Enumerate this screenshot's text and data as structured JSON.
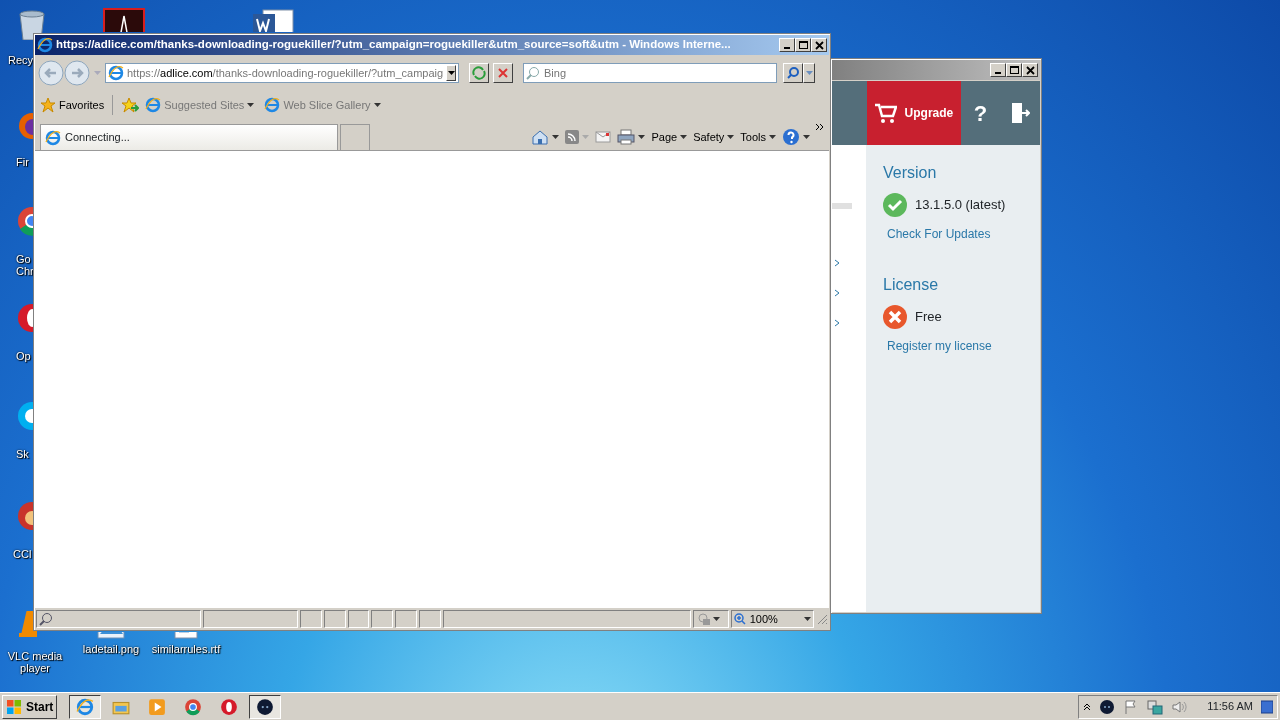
{
  "desktop_icons": [
    {
      "kind": "recycle-bin",
      "lines": [
        "Recy"
      ]
    },
    {
      "kind": "firefox",
      "lines": [
        "Fir"
      ]
    },
    {
      "kind": "chrome",
      "lines": [
        "Go",
        "Chr"
      ]
    },
    {
      "kind": "opera",
      "lines": [
        "Op"
      ]
    },
    {
      "kind": "skype",
      "lines": [
        "Sk"
      ]
    },
    {
      "kind": "ccleaner",
      "lines": [
        "CCl"
      ]
    },
    {
      "kind": "vlc",
      "lines": [
        "VLC media",
        "player"
      ]
    },
    {
      "kind": "image",
      "lines": [
        "ladetail.png"
      ]
    },
    {
      "kind": "document",
      "lines": [
        "similarrules.rtf"
      ]
    },
    {
      "kind": "pdf"
    },
    {
      "kind": "word"
    }
  ],
  "app_window": {
    "upgrade": "Upgrade",
    "help": "?",
    "sections": [
      {
        "heading": "Version",
        "kind": "ok",
        "value": "13.1.5.0 (latest)",
        "link": "Check For Updates"
      },
      {
        "heading": "License",
        "kind": "error",
        "value": "Free",
        "link": "Register my license"
      }
    ]
  },
  "browser": {
    "title": "https://adlice.com/thanks-downloading-roguekiller/?utm_campaign=roguekiller&utm_source=soft&utm - Windows Interne...",
    "address": {
      "scheme": "https://",
      "host": "adlice.com",
      "path": "/thanks-downloading-roguekiller/?utm_campaig"
    },
    "search": {
      "placeholder": "Bing"
    },
    "favorites": {
      "label": "Favorites",
      "links": [
        "Suggested Sites",
        "Web Slice Gallery"
      ]
    },
    "tab": {
      "label": "Connecting..."
    },
    "commands": [
      "Page",
      "Safety",
      "Tools"
    ],
    "zoom": "100%"
  },
  "taskbar": {
    "start": "Start",
    "items": [
      {
        "kind": "ie",
        "selected": true
      },
      {
        "kind": "explorer",
        "selected": false
      },
      {
        "kind": "media",
        "selected": false
      },
      {
        "kind": "chrome",
        "selected": false
      },
      {
        "kind": "opera",
        "selected": false
      },
      {
        "kind": "app",
        "selected": true
      }
    ],
    "clock": "11:56 AM"
  }
}
